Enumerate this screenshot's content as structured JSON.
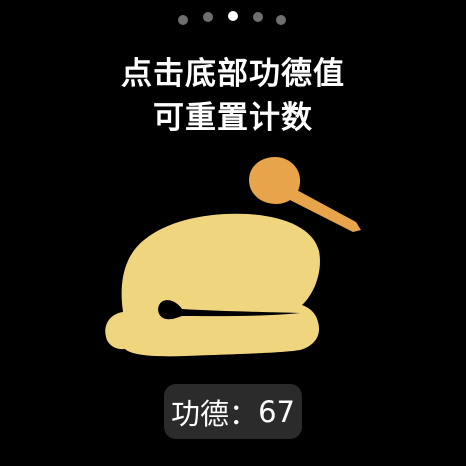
{
  "pager": {
    "total": 5,
    "active_index": 2
  },
  "instruction": {
    "line1": "点击底部功德值",
    "line2": "可重置计数"
  },
  "counter": {
    "label": "功德",
    "separator": "：",
    "value": "67"
  },
  "colors": {
    "background": "#000000",
    "fish": "#f0d57f",
    "mallet": "#e8a44a",
    "fish_slit": "#000000",
    "counter_bg": "#2b2b2b",
    "dot_inactive": "#6f6f6f",
    "dot_active": "#ffffff"
  },
  "icons": {
    "main": "wooden-fish-icon",
    "mallet": "mallet-icon"
  }
}
